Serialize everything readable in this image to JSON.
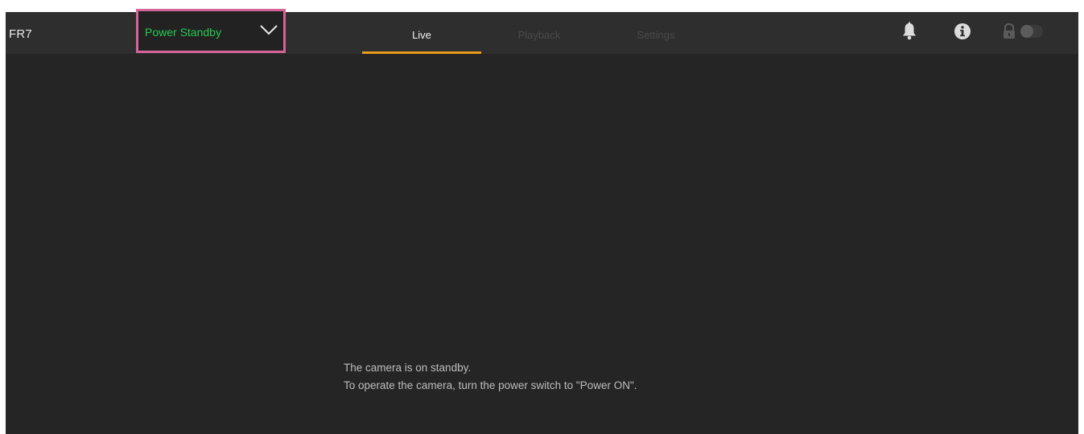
{
  "header": {
    "app_title": "FR7",
    "power_status": "Power Standby",
    "tabs": [
      {
        "label": "Live",
        "active": true
      },
      {
        "label": "Playback",
        "active": false
      },
      {
        "label": "Settings",
        "active": false
      }
    ],
    "icons": [
      "bell-icon",
      "info-icon",
      "lock-icon"
    ]
  },
  "main": {
    "message_line1": "The camera is on standby.",
    "message_line2": "To operate the camera, turn the power switch to \"Power ON\"."
  },
  "colors": {
    "background": "#252525",
    "header": "#2e2e2e",
    "power_status": "#28c850",
    "active_tab_underline": "#e89a1c",
    "highlight_border": "#d6649a"
  }
}
